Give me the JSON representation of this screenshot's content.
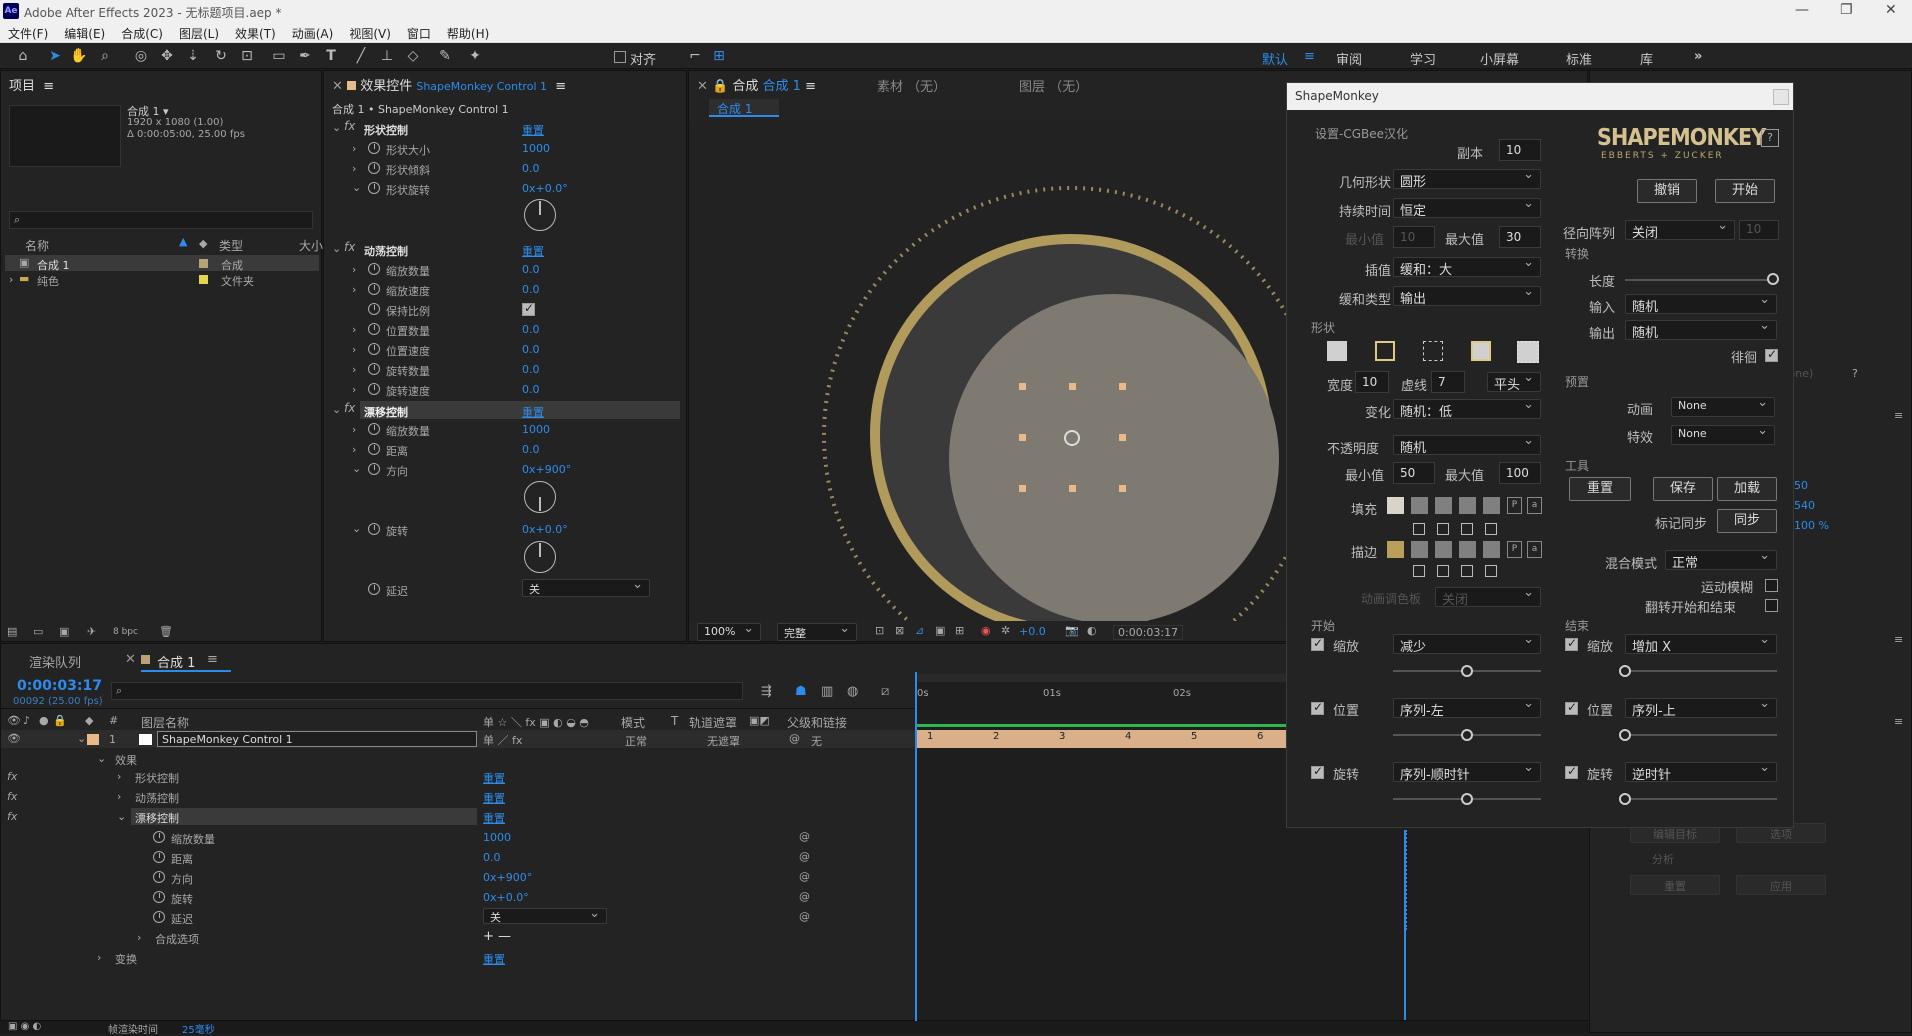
{
  "titlebar": {
    "logo": "Ae",
    "title": "Adobe After Effects 2023 - 无标题项目.aep *"
  },
  "menu": [
    "文件(F)",
    "编辑(E)",
    "合成(C)",
    "图层(L)",
    "效果(T)",
    "动画(A)",
    "视图(V)",
    "窗口",
    "帮助(H)"
  ],
  "toolbar": {
    "align": "对齐"
  },
  "workspaces": {
    "active": "默认",
    "items": [
      "审阅",
      "学习",
      "小屏幕",
      "标准",
      "库"
    ]
  },
  "project": {
    "title": "项目",
    "comp_name": "合成 1 ▾",
    "comp_info1": "1920 x 1080 (1.00)",
    "comp_info2": "Δ 0:00:05:00, 25.00 fps",
    "col_name": "名称",
    "col_type": "类型",
    "col_size": "大小",
    "items": [
      {
        "name": "合成 1",
        "type": "合成",
        "color": "#b8a27a"
      },
      {
        "name": "纯色",
        "type": "文件夹",
        "color": "#e6d34f"
      }
    ],
    "bpc": "8 bpc"
  },
  "effects": {
    "title": "效果控件",
    "layer": "ShapeMonkey Control 1",
    "breadcrumb": "合成 1 • ShapeMonkey Control 1",
    "groups": [
      {
        "name": "形状控制",
        "reset": "重置",
        "props": [
          {
            "n": "形状大小",
            "v": "1000"
          },
          {
            "n": "形状倾斜",
            "v": "0.0"
          },
          {
            "n": "形状旋转",
            "v": "0x+0.0°"
          }
        ]
      },
      {
        "name": "动荡控制",
        "reset": "重置",
        "props": [
          {
            "n": "缩放数量",
            "v": "0.0"
          },
          {
            "n": "缩放速度",
            "v": "0.0"
          },
          {
            "n": "保持比例",
            "v": ""
          },
          {
            "n": "位置数量",
            "v": "0.0"
          },
          {
            "n": "位置速度",
            "v": "0.0"
          },
          {
            "n": "旋转数量",
            "v": "0.0"
          },
          {
            "n": "旋转速度",
            "v": "0.0"
          }
        ]
      },
      {
        "name": "漂移控制",
        "reset": "重置",
        "props": [
          {
            "n": "缩放数量",
            "v": "1000"
          },
          {
            "n": "距离",
            "v": "0.0"
          },
          {
            "n": "方向",
            "v": "0x+900°"
          },
          {
            "n": "旋转",
            "v": "0x+0.0°"
          },
          {
            "n": "延迟",
            "v": "关"
          }
        ]
      }
    ]
  },
  "comp": {
    "title": "合成",
    "name": "合成 1",
    "footage": "素材 （无）",
    "layer": "图层 （无）",
    "tab": "合成 1",
    "zoom": "100%",
    "quality": "完整",
    "exposure": "+0.0",
    "timecode": "0:00:03:17"
  },
  "sm": {
    "title": "ShapeMonkey",
    "settings": "设置-CGBee汉化",
    "copies_label": "副本",
    "copies": "10",
    "geometry_label": "几何形状",
    "geometry": "圆形",
    "duration_label": "持续时间",
    "duration": "恒定",
    "min_label": "最小值",
    "min": "10",
    "max_label": "最大值",
    "max": "30",
    "interp_label": "插值",
    "interp": "缓和：大",
    "ease_label": "缓和类型",
    "ease": "输出",
    "shape_label": "形状",
    "width_label": "宽度",
    "width": "10",
    "dash_label": "虚线",
    "dash": "7",
    "cap": "平头",
    "vary_label": "变化",
    "vary": "随机：低",
    "opacity_label": "不透明度",
    "opacity": "随机",
    "omin_label": "最小值",
    "omin": "50",
    "omax_label": "最大值",
    "omax": "100",
    "fill_label": "填充",
    "stroke_label": "描边",
    "fill_colors": [
      "#d9d4ca",
      "#808080",
      "#808080",
      "#808080",
      "#808080"
    ],
    "stroke_colors": [
      "#b8a05a",
      "#808080",
      "#808080",
      "#808080",
      "#808080"
    ],
    "palette_label": "动画调色板",
    "palette": "关闭",
    "logo_top": "SHAPEMONKEY",
    "logo_sub": "EBBERTS + ZUCKER",
    "help": "?",
    "undo": "撤销",
    "start": "开始",
    "radial_label": "径向阵列",
    "radial": "关闭",
    "radial_val": "10",
    "transform_label": "转换",
    "length_label": "长度",
    "in_label": "输入",
    "in": "随机",
    "out_label": "输出",
    "out": "随机",
    "hold_label": "徘徊",
    "preset_label": "预置",
    "anim_label": "动画",
    "anim": "None",
    "fx_label": "特效",
    "fx": "None",
    "tools_label": "工具",
    "reset": "重置",
    "save": "保存",
    "load": "加载",
    "marker_label": "标记同步",
    "sync": "同步",
    "blend_label": "混合模式",
    "blend": "正常",
    "motion_blur": "运动模糊",
    "flip": "翻转开始和结束",
    "begin_label": "开始",
    "end_label": "结束",
    "scale_label": "缩放",
    "pos_label": "位置",
    "rot_label": "旋转",
    "b_scale": "减少",
    "b_pos": "序列-左",
    "b_rot": "序列-顺时针",
    "e_scale": "增加 X",
    "e_pos": "序列-上",
    "e_rot": "逆时针"
  },
  "right": {
    "v1": "50",
    "v2": "540",
    "v3": "100 %",
    "none": "(None)",
    "b1": "编辑目标",
    "b2": "选项",
    "analyze": "分析",
    "reset": "重置",
    "apply": "应用"
  },
  "timeline": {
    "render_tab": "渲染队列",
    "comp_tab": "合成 1",
    "time": "0:00:03:17",
    "frames": "00092 (25.00 fps)",
    "col_name": "图层名称",
    "col_mode": "模式",
    "col_t": "T",
    "col_track": "轨道遮罩",
    "col_parent": "父级和链接",
    "layer_num": "1",
    "layer_name": "ShapeMonkey Control 1",
    "mode": "正常",
    "track": "无遮罩",
    "parent": "无",
    "effects": "效果",
    "groups": [
      {
        "n": "形状控制",
        "r": "重置"
      },
      {
        "n": "动荡控制",
        "r": "重置"
      },
      {
        "n": "漂移控制",
        "r": "重置"
      }
    ],
    "props": [
      {
        "n": "缩放数量",
        "v": "1000"
      },
      {
        "n": "距离",
        "v": "0.0"
      },
      {
        "n": "方向",
        "v": "0x+900°"
      },
      {
        "n": "旋转",
        "v": "0x+0.0°"
      },
      {
        "n": "延迟",
        "v": "关"
      }
    ],
    "comp_opts": "合成选项",
    "comp_opts_v": "+ —",
    "transform": "变换",
    "transform_r": "重置",
    "ruler": [
      "0s",
      "01s",
      "02s"
    ],
    "markers": [
      "1",
      "2",
      "3",
      "4",
      "5",
      "6"
    ],
    "status": "帧渲染时间",
    "status_v": "25毫秒"
  }
}
